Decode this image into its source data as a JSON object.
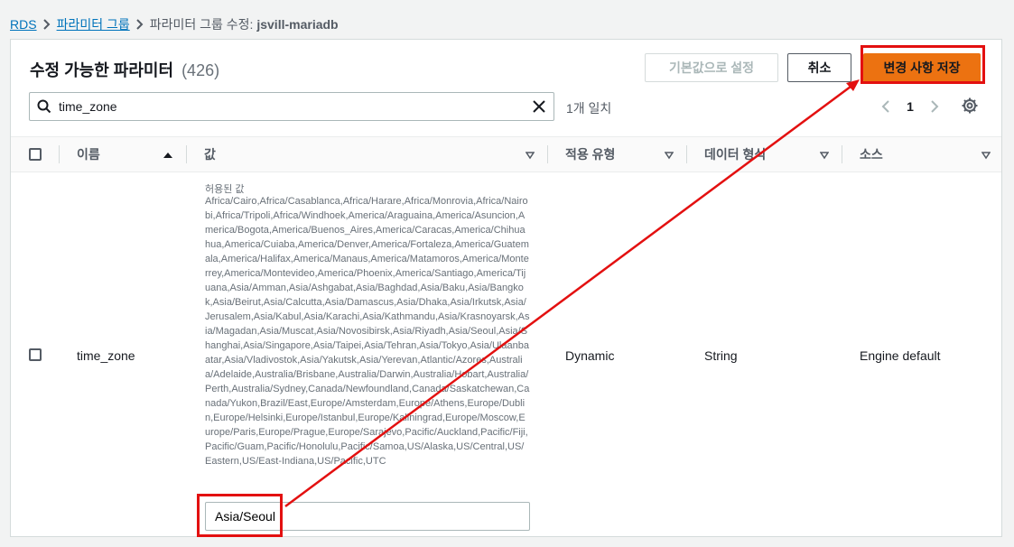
{
  "breadcrumb": {
    "rds": "RDS",
    "param_groups": "파라미터 그룹",
    "current_prefix": "파라미터 그룹 수정: ",
    "current_name": "jsvill-mariadb"
  },
  "panel": {
    "title": "수정 가능한 파라미터",
    "count": "(426)"
  },
  "buttons": {
    "reset_defaults": "기본값으로 설정",
    "cancel": "취소",
    "save_changes": "변경 사항 저장"
  },
  "search": {
    "value": "time_zone",
    "match_count": "1개 일치"
  },
  "pagination": {
    "current_page": "1"
  },
  "table": {
    "columns": {
      "name": "이름",
      "value": "값",
      "apply_type": "적용 유형",
      "data_type": "데이터 형식",
      "source": "소스"
    },
    "rows": [
      {
        "name": "time_zone",
        "allowed_label": "허용된 값",
        "allowed_values": "Africa/Cairo,Africa/Casablanca,Africa/Harare,Africa/Monrovia,Africa/Nairobi,Africa/Tripoli,Africa/Windhoek,America/Araguaina,America/Asuncion,America/Bogota,America/Buenos_Aires,America/Caracas,America/Chihuahua,America/Cuiaba,America/Denver,America/Fortaleza,America/Guatemala,America/Halifax,America/Manaus,America/Matamoros,America/Monterrey,America/Montevideo,America/Phoenix,America/Santiago,America/Tijuana,Asia/Amman,Asia/Ashgabat,Asia/Baghdad,Asia/Baku,Asia/Bangkok,Asia/Beirut,Asia/Calcutta,Asia/Damascus,Asia/Dhaka,Asia/Irkutsk,Asia/Jerusalem,Asia/Kabul,Asia/Karachi,Asia/Kathmandu,Asia/Krasnoyarsk,Asia/Magadan,Asia/Muscat,Asia/Novosibirsk,Asia/Riyadh,Asia/Seoul,Asia/Shanghai,Asia/Singapore,Asia/Taipei,Asia/Tehran,Asia/Tokyo,Asia/Ulaanbaatar,Asia/Vladivostok,Asia/Yakutsk,Asia/Yerevan,Atlantic/Azores,Australia/Adelaide,Australia/Brisbane,Australia/Darwin,Australia/Hobart,Australia/Perth,Australia/Sydney,Canada/Newfoundland,Canada/Saskatchewan,Canada/Yukon,Brazil/East,Europe/Amsterdam,Europe/Athens,Europe/Dublin,Europe/Helsinki,Europe/Istanbul,Europe/Kaliningrad,Europe/Moscow,Europe/Paris,Europe/Prague,Europe/Sarajevo,Pacific/Auckland,Pacific/Fiji,Pacific/Guam,Pacific/Honolulu,Pacific/Samoa,US/Alaska,US/Central,US/Eastern,US/East-Indiana,US/Pacific,UTC",
        "value": "Asia/Seoul",
        "apply_type": "Dynamic",
        "data_type": "String",
        "source": "Engine default"
      }
    ]
  },
  "colors": {
    "link": "#0073bb",
    "primary_button": "#ec7211",
    "annotation": "#e31010"
  }
}
